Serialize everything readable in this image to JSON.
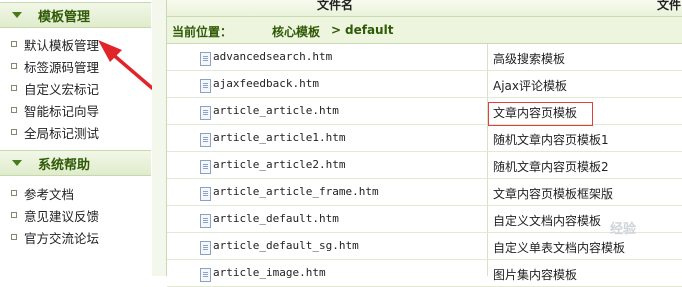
{
  "sidebar": {
    "sections": [
      {
        "title": "模板管理",
        "items": [
          "默认模板管理",
          "标签源码管理",
          "自定义宏标记",
          "智能标记向导",
          "全局标记测试"
        ]
      },
      {
        "title": "系统帮助",
        "items": [
          "参考文档",
          "意见建议反馈",
          "官方交流论坛"
        ]
      }
    ]
  },
  "table": {
    "header": {
      "col1": "文件名",
      "col2": "文件"
    },
    "breadcrumb": {
      "prefix": "当前位置：",
      "path": "核心模板",
      "separator": ">",
      "current": "default"
    },
    "rows": [
      {
        "file": "advancedsearch.htm",
        "desc": "高级搜索模板"
      },
      {
        "file": "ajaxfeedback.htm",
        "desc": "Ajax评论模板"
      },
      {
        "file": "article_article.htm",
        "desc": "文章内容页模板"
      },
      {
        "file": "article_article1.htm",
        "desc": "随机文章内容页模板1"
      },
      {
        "file": "article_article2.htm",
        "desc": "随机文章内容页模板2"
      },
      {
        "file": "article_article_frame.htm",
        "desc": "文章内容页模板框架版"
      },
      {
        "file": "article_default.htm",
        "desc": "自定义文档内容模板"
      },
      {
        "file": "article_default_sg.htm",
        "desc": "自定义单表文档内容模板"
      },
      {
        "file": "article_image.htm",
        "desc": "图片集内容模板"
      }
    ]
  },
  "watermark": "经验",
  "colors": {
    "accent": "#2f5a06",
    "highlight": "#e0403a",
    "arrow": "#e0252a"
  }
}
